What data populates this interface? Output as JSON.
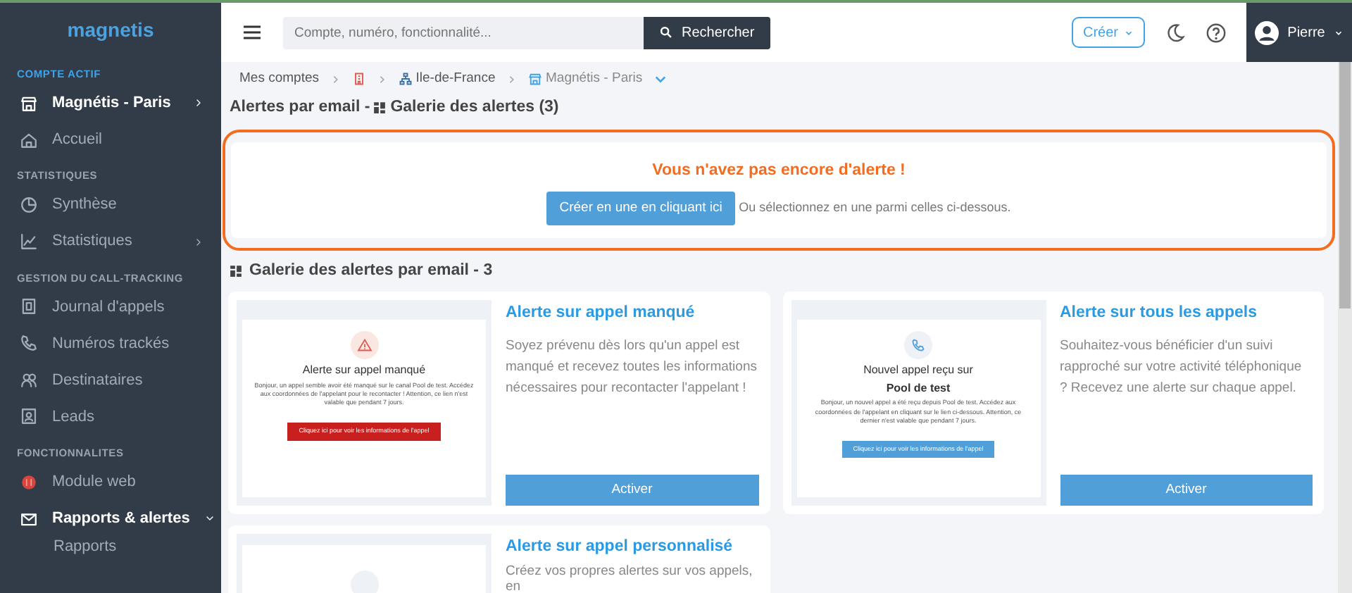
{
  "sidebar": {
    "logo": "magnetis",
    "items": [
      {
        "kind": "section",
        "label": "COMPTE ACTIF"
      },
      {
        "kind": "account",
        "label": "Magnétis - Paris",
        "expanded": false,
        "selected": true
      },
      {
        "kind": "link",
        "label": "Accueil",
        "selected": false
      },
      {
        "kind": "section",
        "label": "STATISTIQUES"
      },
      {
        "kind": "link",
        "label": "Synthèse",
        "selected": false
      },
      {
        "kind": "group",
        "label": "Statistiques",
        "expanded": false,
        "selected": false
      },
      {
        "kind": "section",
        "label": "GESTION DU CALL-TRACKING"
      },
      {
        "kind": "link",
        "label": "Journal d'appels",
        "selected": false
      },
      {
        "kind": "link",
        "label": "Numéros trackés",
        "selected": false
      },
      {
        "kind": "link",
        "label": "Destinataires",
        "selected": false
      },
      {
        "kind": "link",
        "label": "Leads",
        "selected": false
      },
      {
        "kind": "section",
        "label": "FONCTIONNALITES"
      },
      {
        "kind": "link",
        "label": "Module web",
        "selected": false
      },
      {
        "kind": "group",
        "label": "Rapports & alertes",
        "expanded": true,
        "selected": true
      },
      {
        "kind": "sub",
        "label": "Rapports",
        "selected": false
      }
    ]
  },
  "topbar": {
    "search": {
      "placeholder": "Compte, numéro, fonctionnalité..."
    },
    "search_button": "Rechercher",
    "create_button": "Créer",
    "user": "Pierre"
  },
  "breadcrumb": [
    {
      "kind": "text",
      "label": "Mes comptes"
    },
    {
      "kind": "building"
    },
    {
      "kind": "network",
      "label": "Ile-de-France"
    },
    {
      "kind": "store",
      "label": "Magnétis - Paris"
    }
  ],
  "page_title": {
    "prefix": "Alertes par email -",
    "title": "Galerie des alertes (3)"
  },
  "empty_state": {
    "message": "Vous n'avez pas encore d'alerte !",
    "button": "Créer en une en cliquant ici",
    "hint": "Ou sélectionnez en une parmi celles ci-dessous."
  },
  "gallery_title": "Galerie des alertes par email - 3",
  "cards": [
    {
      "kind": "missed",
      "title": "Alerte sur appel manqué",
      "description": "Soyez prévenu dès lors qu'un appel est manqué et recevez toutes les informations nécessaires pour recontacter l'appelant !",
      "button": "Activer",
      "preview": {
        "heading": "Alerte sur appel manqué",
        "body": "Bonjour, un appel semble avoir été manqué sur le canal Pool de test. Accédez aux coordonnées de l'appelant pour le recontacter ! Attention, ce lien n'est valable que pendant 7 jours.",
        "button": "Cliquez ici pour voir les informations de l'appel"
      }
    },
    {
      "kind": "all",
      "title": "Alerte sur tous les appels",
      "description": "Souhaitez-vous bénéficier d'un suivi rapproché sur votre activité téléphonique ? Recevez une alerte sur chaque appel.",
      "button": "Activer",
      "preview": {
        "heading": "Nouvel appel reçu sur",
        "subheading": "Pool de test",
        "body": "Bonjour, un nouvel appel a été reçu depuis Pool de test. Accédez aux coordonnées de l'appelant en cliquant sur le lien ci-dessous. Attention, ce dernier n'est valable que pendant 7 jours.",
        "button": "Cliquez ici pour voir les informations de l'appel"
      }
    },
    {
      "kind": "custom",
      "title": "Alerte sur appel personnalisé",
      "description": "Créez vos propres alertes sur vos appels, en"
    }
  ]
}
